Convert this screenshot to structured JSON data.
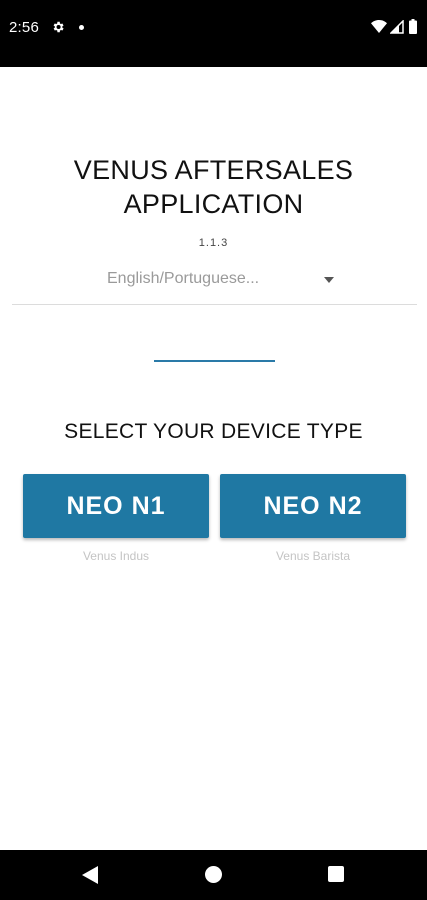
{
  "status_bar": {
    "time": "2:56",
    "icons": [
      "gear-icon",
      "notification-dot-icon",
      "wifi-icon",
      "signal-icon",
      "battery-icon"
    ]
  },
  "header": {
    "title": "VENUS AFTERSALES APPLICATION",
    "version": "1.1.3"
  },
  "language_select": {
    "selected": "English/Portuguese..."
  },
  "device_section": {
    "heading": "SELECT YOUR DEVICE TYPE",
    "devices": [
      {
        "label": "NEO N1",
        "caption": "Venus Indus"
      },
      {
        "label": "NEO N2",
        "caption": "Venus Barista"
      }
    ]
  },
  "nav_bar": {
    "icons": [
      "back-icon",
      "home-icon",
      "recents-icon"
    ]
  },
  "colors": {
    "accent": "#2a7aa8",
    "button": "#1f78a3",
    "status_bar": "#000000"
  }
}
